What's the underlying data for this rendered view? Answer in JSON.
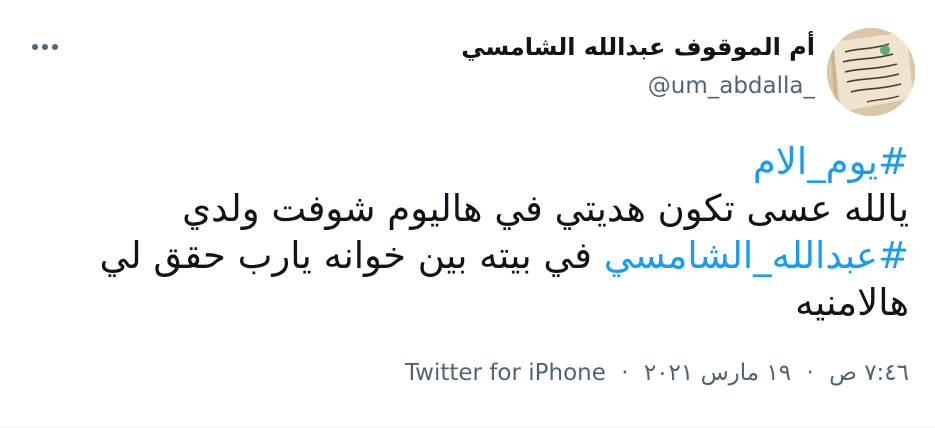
{
  "tweet": {
    "author": {
      "display_name": "أم الموقوف عبدالله الشامسي",
      "handle": "@um_abdalla_",
      "avatar_icon": "handwritten-paper-avatar"
    },
    "more_icon": "more-options-icon",
    "text": {
      "line1_hashtag": "#يوم_الام",
      "line2": "يالله عسى تكون هديتي في هاليوم شوفت ولدي",
      "line3_hashtag": "#عبدالله_الشامسي",
      "line3_text": " في بيته بين خوانه يارب حقق لي",
      "line4": "هالامنيه"
    },
    "meta": {
      "time": "٧:٤٦ ص",
      "separator": "·",
      "date": "١٩ مارس ٢٠٢١",
      "source": "Twitter for iPhone"
    },
    "colors": {
      "hashtag": "#1d9bf0",
      "secondary_text": "#536471",
      "primary_text": "#0f1419"
    }
  }
}
